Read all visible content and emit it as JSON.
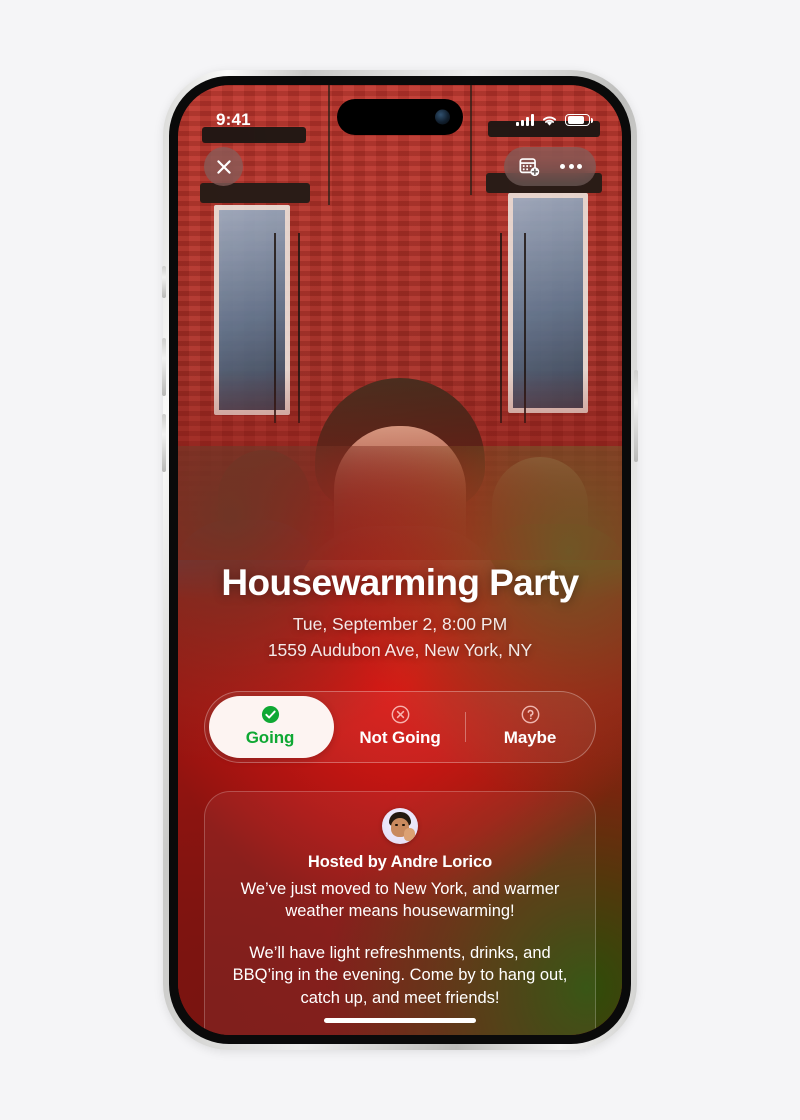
{
  "statusbar": {
    "time": "9:41",
    "cellular_icon": "cellular-signal-icon",
    "wifi_icon": "wifi-icon",
    "battery_icon": "battery-icon"
  },
  "topbar": {
    "close_icon": "close-icon",
    "add_to_calendar_icon": "calendar-add-icon",
    "more_icon": "more-options-icon"
  },
  "event": {
    "title": "Housewarming Party",
    "datetime": "Tue, September 2, 8:00 PM",
    "address": "1559 Audubon Ave, New York, NY"
  },
  "rsvp": {
    "selected": "Going",
    "options": [
      {
        "label": "Going",
        "icon": "check-circle-icon",
        "selected": true
      },
      {
        "label": "Not Going",
        "icon": "x-circle-icon",
        "selected": false
      },
      {
        "label": "Maybe",
        "icon": "question-circle-icon",
        "selected": false
      }
    ]
  },
  "host_card": {
    "avatar_icon": "host-avatar",
    "host_line": "Hosted by Andre Lorico",
    "paragraphs": [
      "We’ve just moved to New York, and warmer weather means housewarming!",
      "We’ll have light refreshments, drinks, and BBQ’ing in the evening. Come by to hang out, catch up, and meet friends!"
    ]
  },
  "colors": {
    "accent_green": "#0fa834",
    "selected_pill": "#fdf4f2",
    "background_red": "#a81612",
    "background_green": "#2f4d0a",
    "page_background": "#f5f5f7"
  },
  "home_indicator": "home-indicator"
}
